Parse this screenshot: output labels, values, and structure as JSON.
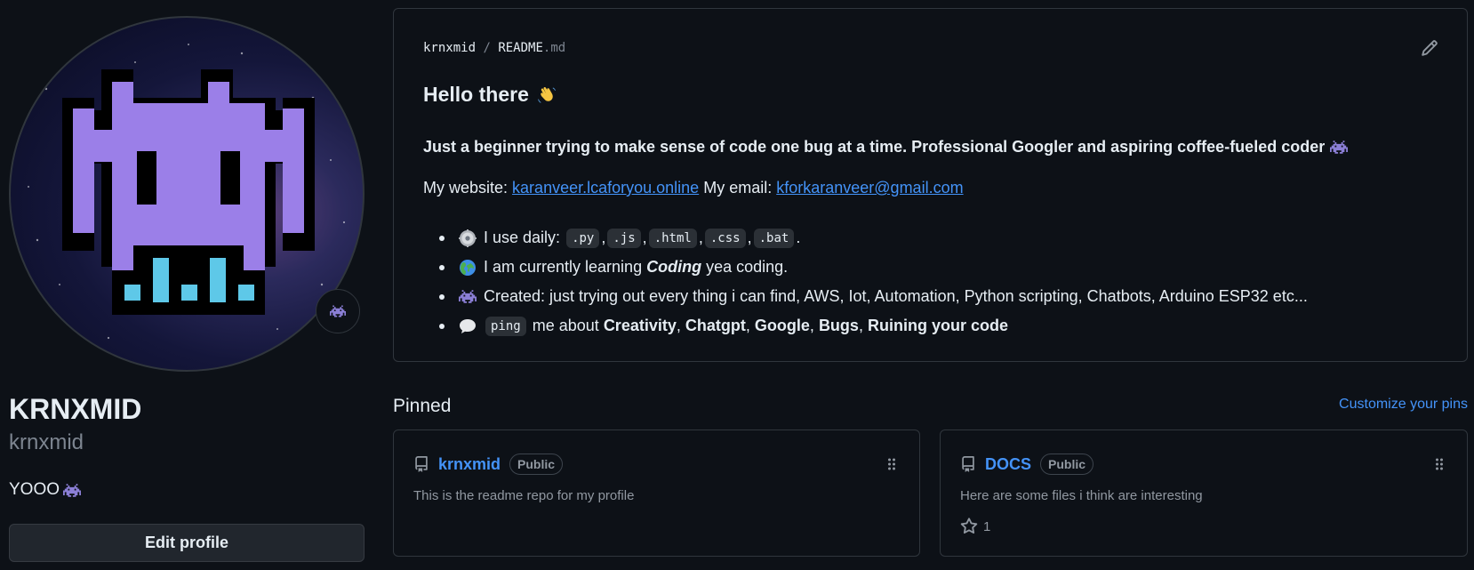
{
  "profile": {
    "name": "KRNXMID",
    "login": "krnxmid",
    "bio": "YOOO",
    "status_icon": "alien-monster-icon",
    "edit_button": "Edit profile"
  },
  "readme": {
    "owner": "krnxmid",
    "separator": "/",
    "file_base": "README",
    "file_ext": ".md",
    "heading": "Hello there",
    "heading_icon": "waving-hand-icon",
    "tagline": "Just a beginner trying to make sense of code one bug at a time. Professional Googler and aspiring coffee-fueled coder",
    "website_label": "My website:",
    "website_link": "karanveer.lcaforyou.online",
    "email_label": "My email:",
    "email_link": "kforkaranveer@gmail.com",
    "list": {
      "daily": {
        "icon": "gear-icon",
        "text": "I use daily:",
        "codes": [
          ".py",
          ".js",
          ".html",
          ".css",
          ".bat"
        ],
        "separator": ",",
        "end": "."
      },
      "learning": {
        "icon": "globe-icon",
        "prefix": "I am currently learning",
        "emphasis": "Coding",
        "suffix": "yea coding."
      },
      "created": {
        "icon": "alien-monster-icon",
        "text": "Created: just trying out every thing i can find, AWS, Iot, Automation, Python scripting, Chatbots, Arduino ESP32 etc..."
      },
      "ping": {
        "icon": "speech-bubble-icon",
        "code": "ping",
        "text": "me about",
        "topics": [
          "Creativity",
          "Chatgpt",
          "Google",
          "Bugs",
          "Ruining your code"
        ],
        "separator": ","
      }
    }
  },
  "pinned": {
    "heading": "Pinned",
    "customize": "Customize your pins",
    "repos": [
      {
        "name": "krnxmid",
        "visibility": "Public",
        "description": "This is the readme repo for my profile",
        "stars": ""
      },
      {
        "name": "DOCS",
        "visibility": "Public",
        "description": "Here are some files i think are interesting",
        "stars": "1"
      }
    ]
  },
  "colors": {
    "background": "#0d1117",
    "accent_link": "#4493f8",
    "avatar_purple": "#9b7fe8",
    "avatar_cyan": "#5ec8e8"
  }
}
